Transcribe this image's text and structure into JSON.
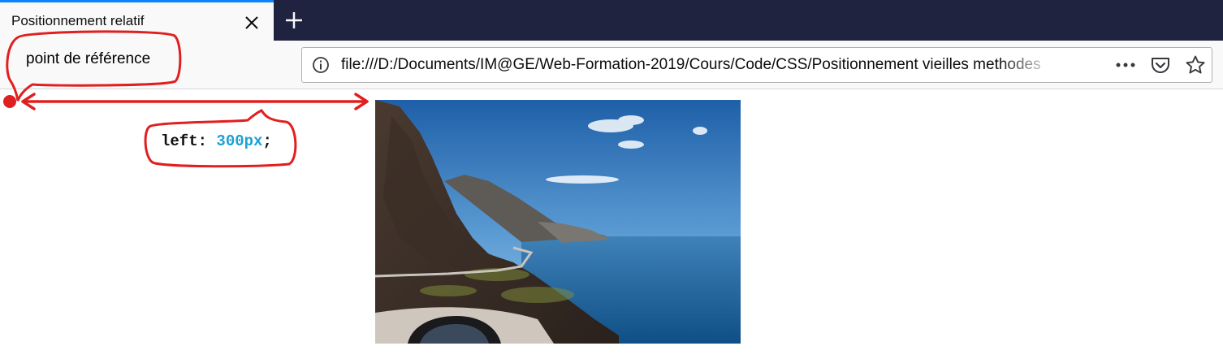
{
  "tab": {
    "title": "Positionnement relatif",
    "close_icon": "close-icon",
    "new_tab_icon": "plus-icon"
  },
  "navbar": {
    "url": "file:///D:/Documents/IM@GE/Web-Formation-2019/Cours/Code/CSS/Positionnement vieilles methodes",
    "icons": [
      "info-icon",
      "more-icon",
      "pocket-icon",
      "star-icon"
    ]
  },
  "annotation": {
    "reference_label": "point de référence",
    "code_property": "left:",
    "code_value": "300px",
    "code_semicolon": ";",
    "color": "#e02020"
  },
  "content": {
    "image_description": "coastal-cliff-road-photo"
  },
  "colors": {
    "tabstrip": "#202340",
    "tab_accent": "#0a84ff",
    "annotation_red": "#e02020",
    "code_value_blue": "#1ba1d9"
  }
}
